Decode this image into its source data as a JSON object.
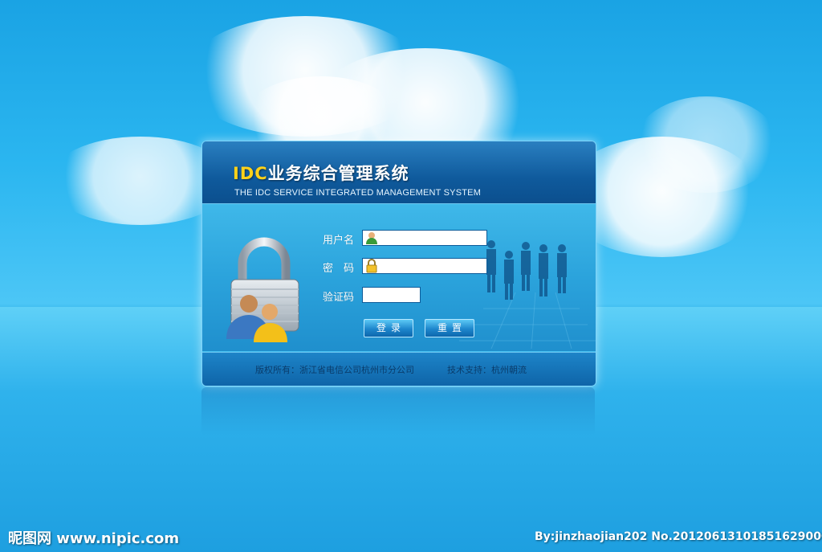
{
  "header": {
    "title_prefix": "IDC",
    "title_main": "业务综合管理系统",
    "subtitle": "THE IDC SERVICE INTEGRATED MANAGEMENT SYSTEM"
  },
  "form": {
    "username_label": "用户名",
    "password_label": "密　码",
    "captcha_label": "验证码",
    "username_value": "",
    "password_value": "",
    "captcha_value": "",
    "login_button": "登录",
    "reset_button": "重置"
  },
  "footer": {
    "copyright": "版权所有：浙江省电信公司杭州市分公司",
    "support": "技术支持：杭州朝流"
  },
  "watermark": {
    "site": "昵图网 www.nipic.com",
    "credit": "By:jinzhaojian202  No.20120613101851629000"
  },
  "colors": {
    "sky": "#2bb6f0",
    "header": "#0f5a9c",
    "accent_yellow": "#ffd21a"
  },
  "icons": {
    "user": "user-icon",
    "password": "lock-icon",
    "hero": "padlock-users-icon",
    "silhouettes": "business-people-silhouette"
  }
}
